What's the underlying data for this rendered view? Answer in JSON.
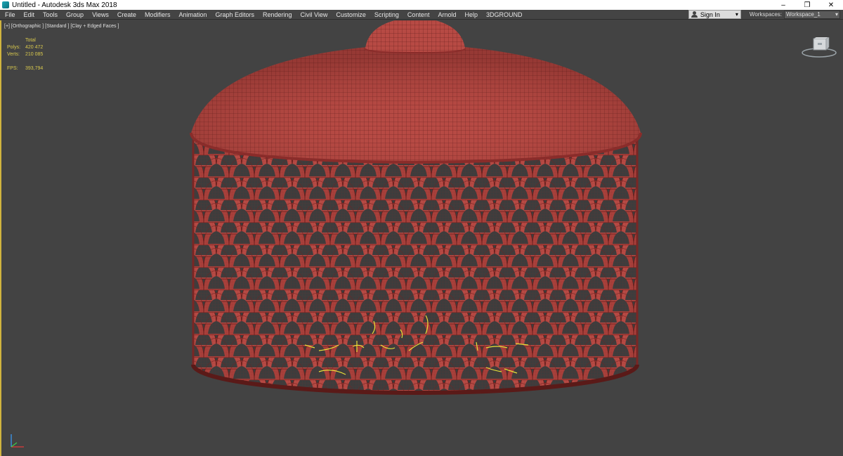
{
  "window": {
    "title": "Untitled - Autodesk 3ds Max 2018",
    "minimize": "–",
    "restore": "❐",
    "close": "✕"
  },
  "menu": [
    "File",
    "Edit",
    "Tools",
    "Group",
    "Views",
    "Create",
    "Modifiers",
    "Animation",
    "Graph Editors",
    "Rendering",
    "Civil View",
    "Customize",
    "Scripting",
    "Content",
    "Arnold",
    "Help",
    "3DGROUND"
  ],
  "account": {
    "sign_in": "Sign In",
    "caret": "▾"
  },
  "workspaces": {
    "label": "Workspaces:",
    "value": "Workspace_1",
    "caret": "▾"
  },
  "viewport": {
    "label": "[+] [Orthographic ] [Standard ] [Clay + Edged Faces ]",
    "stats": {
      "header": "Total",
      "polys_label": "Polys:",
      "polys": "420 472",
      "verts_label": "Verts:",
      "verts": "210 085",
      "fps_label": "FPS:",
      "fps": "393,794"
    }
  },
  "colors": {
    "mesh_fill": "#b74a44",
    "mesh_dark": "#8a2c2a",
    "wire": "#5a1a18",
    "background": "#434343",
    "highlight": "#e8e038"
  }
}
